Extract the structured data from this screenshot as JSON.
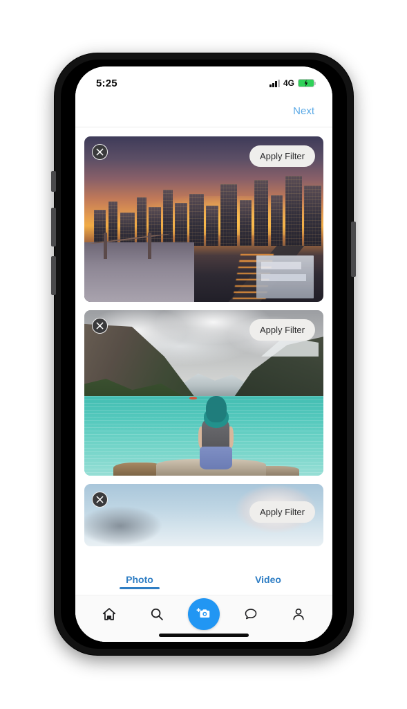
{
  "status_bar": {
    "time": "5:25",
    "network_label": "4G",
    "signal_icon": "signal-bars-icon",
    "battery_icon": "battery-charging-icon",
    "battery_color": "#2fd158",
    "signal_bars_filled": 3,
    "signal_bars_total": 4
  },
  "top_bar": {
    "next_label": "Next",
    "next_color": "#5aa9e6"
  },
  "feed": {
    "cards": [
      {
        "close_icon": "close-circle-icon",
        "filter_label": "Apply Filter",
        "photo_name": "city-skyline-sunset-photo",
        "alt": "City skyline at sunset with bridge and river"
      },
      {
        "close_icon": "close-circle-icon",
        "filter_label": "Apply Filter",
        "photo_name": "lake-mountains-photo",
        "alt": "Woman with teal hair sitting by turquoise mountain lake"
      },
      {
        "close_icon": "close-circle-icon",
        "filter_label": "Apply Filter",
        "photo_name": "sky-clouds-photo",
        "alt": "Sky with clouds"
      }
    ]
  },
  "tabs": [
    {
      "label": "Photo",
      "active": true
    },
    {
      "label": "Video",
      "active": false
    }
  ],
  "tab_accent_color": "#2f7ec4",
  "bottom_nav": {
    "items": [
      {
        "icon": "home-icon",
        "name": "nav-home"
      },
      {
        "icon": "search-icon",
        "name": "nav-search"
      },
      {
        "icon": "camera-add-icon",
        "name": "nav-camera"
      },
      {
        "icon": "chat-bubble-icon",
        "name": "nav-messages"
      },
      {
        "icon": "person-icon",
        "name": "nav-profile"
      }
    ],
    "camera_button_color": "#2196f3"
  }
}
